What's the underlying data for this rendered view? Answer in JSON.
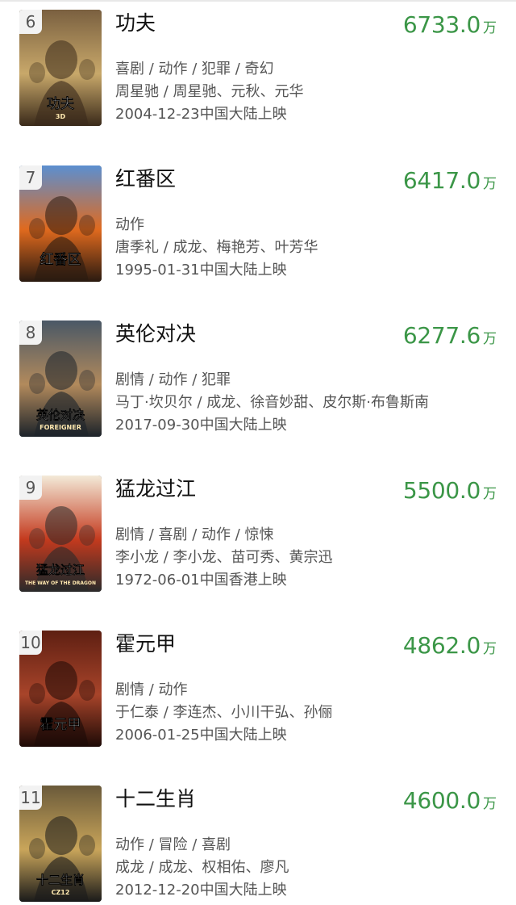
{
  "colors": {
    "box_office_green": "#3b9647",
    "title": "#111111",
    "meta": "#555555",
    "rank_badge_bg": "#f2f2f2"
  },
  "movies": [
    {
      "rank": "6",
      "title": "功夫",
      "box_office": "6733.0",
      "unit": "万",
      "genres": "喜剧 / 动作 / 犯罪 / 奇幻",
      "people": "周星驰 / 周星驰、元秋、元华",
      "release": "2004-12-23中国大陆上映",
      "poster_text": "功夫",
      "poster_subtext": "3D",
      "poster_colors": [
        "#7a6040",
        "#c8a86a",
        "#3a2a1a"
      ]
    },
    {
      "rank": "7",
      "title": "红番区",
      "box_office": "6417.0",
      "unit": "万",
      "genres": "动作",
      "people": "唐季礼 / 成龙、梅艳芳、叶芳华",
      "release": "1995-01-31中国大陆上映",
      "poster_text": "红番区",
      "poster_subtext": "",
      "poster_colors": [
        "#5b8fd0",
        "#e06a1e",
        "#2a1a10"
      ]
    },
    {
      "rank": "8",
      "title": "英伦对决",
      "box_office": "6277.6",
      "unit": "万",
      "genres": "剧情 / 动作 / 犯罪",
      "people": "马丁·坎贝尔 / 成龙、徐音妙甜、皮尔斯·布鲁斯南",
      "release": "2017-09-30中国大陆上映",
      "poster_text": "英伦对决",
      "poster_subtext": "FOREIGNER",
      "poster_colors": [
        "#4a5866",
        "#b28a5c",
        "#1c232a"
      ]
    },
    {
      "rank": "9",
      "title": "猛龙过江",
      "box_office": "5500.0",
      "unit": "万",
      "genres": "剧情 / 喜剧 / 动作 / 惊悚",
      "people": "李小龙 / 李小龙、苗可秀、黄宗迅",
      "release": "1972-06-01中国香港上映",
      "poster_text": "猛龙过江",
      "poster_subtext": "THE WAY OF THE DRAGON",
      "poster_colors": [
        "#f3ead8",
        "#c43a1e",
        "#2a2a2a"
      ]
    },
    {
      "rank": "10",
      "title": "霍元甲",
      "box_office": "4862.0",
      "unit": "万",
      "genres": "剧情 / 动作",
      "people": "于仁泰 / 李连杰、小川干弘、孙俪",
      "release": "2006-01-25中国大陆上映",
      "poster_text": "霍元甲",
      "poster_subtext": "",
      "poster_colors": [
        "#5e1f12",
        "#a8442a",
        "#1d0a06"
      ]
    },
    {
      "rank": "11",
      "title": "十二生肖",
      "box_office": "4600.0",
      "unit": "万",
      "genres": "动作 / 冒险 / 喜剧",
      "people": "成龙 / 成龙、权相佑、廖凡",
      "release": "2012-12-20中国大陆上映",
      "poster_text": "十二生肖",
      "poster_subtext": "CZ12",
      "poster_colors": [
        "#6a5a3a",
        "#c9a55a",
        "#1a1a1a"
      ]
    }
  ]
}
